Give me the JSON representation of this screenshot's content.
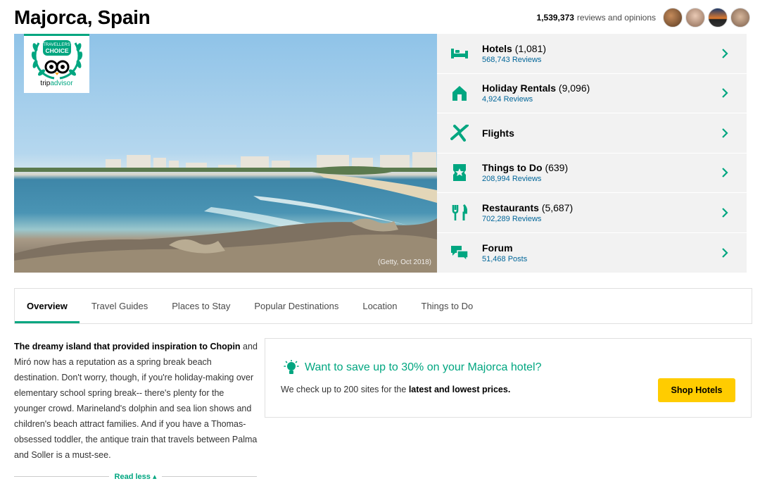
{
  "page": {
    "title": "Majorca, Spain"
  },
  "reviews": {
    "count": "1,539,373",
    "label": "reviews and opinions"
  },
  "hero": {
    "credit": "(Getty, Oct 2018)"
  },
  "badge": {
    "line1": "TRAVELLERS'",
    "line2": "CHOICE",
    "brand_left": "trip",
    "brand_right": "advisor"
  },
  "categories": [
    {
      "name": "Hotels",
      "count": "(1,081)",
      "sub": "568,743 Reviews",
      "icon": "bed-icon"
    },
    {
      "name": "Holiday Rentals",
      "count": "(9,096)",
      "sub": "4,924 Reviews",
      "icon": "house-icon"
    },
    {
      "name": "Flights",
      "count": "",
      "sub": "",
      "icon": "plane-icon"
    },
    {
      "name": "Things to Do",
      "count": "(639)",
      "sub": "208,994 Reviews",
      "icon": "ticket-icon"
    },
    {
      "name": "Restaurants",
      "count": "(5,687)",
      "sub": "702,289 Reviews",
      "icon": "cutlery-icon"
    },
    {
      "name": "Forum",
      "count": "",
      "sub": "51,468 Posts",
      "icon": "chat-icon"
    }
  ],
  "tabs": [
    "Overview",
    "Travel Guides",
    "Places to Stay",
    "Popular Destinations",
    "Location",
    "Things to Do"
  ],
  "overview": {
    "lead": "The dreamy island that provided inspiration to Chopin",
    "body": " and Miró now has a reputation as a spring break beach destination. Don't worry, though, if you're holiday-making over elementary school spring break-- there's plenty for the younger crowd. Marineland's dolphin and sea lion shows and children's beach attract families. And if you have a Thomas-obsessed toddler, the antique train that travels between Palma and Soller is a must-see.",
    "read_less": "Read less ▴"
  },
  "deals": {
    "headline": "Want to save up to 30% on your Majorca hotel?",
    "desc_prefix": "We check up to 200 sites for the ",
    "desc_bold": "latest and lowest prices.",
    "button": "Shop Hotels"
  },
  "colors": {
    "accent": "#00a680",
    "link": "#006699",
    "button": "#ffcc00"
  }
}
